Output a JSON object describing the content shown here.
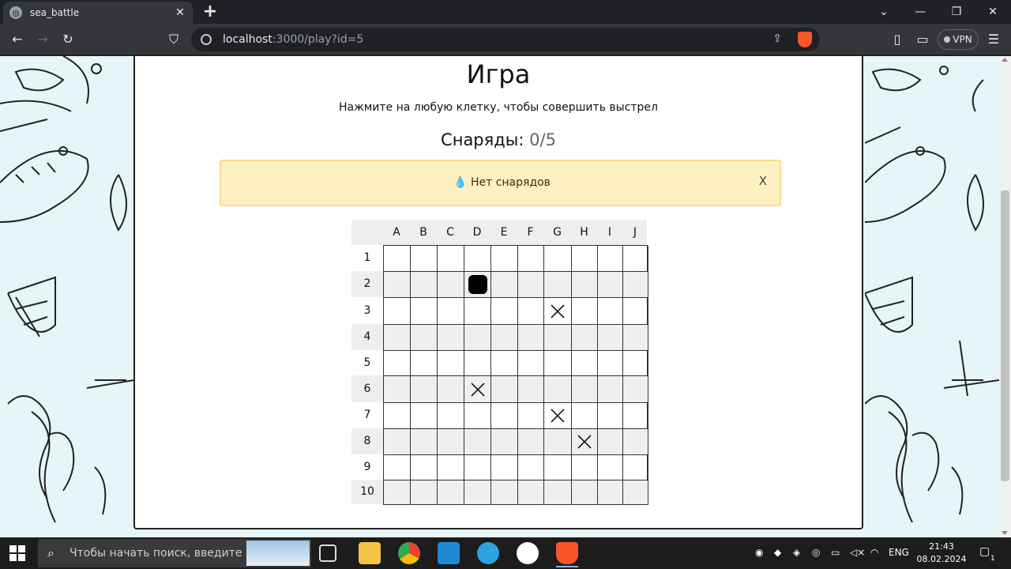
{
  "browser": {
    "tab_title": "sea_battle",
    "url_host": "localhost",
    "url_rest": ":3000/play?id=5",
    "vpn_label": "VPN"
  },
  "page": {
    "title": "Игра",
    "instructions": "Нажмите на любую клетку, чтобы совершить выстрел",
    "ammo_label": "Снаряды:",
    "ammo_value": "0/5",
    "alert_icon": "💧",
    "alert_text": "Нет снарядов",
    "alert_close": "X"
  },
  "board": {
    "columns": [
      "A",
      "B",
      "C",
      "D",
      "E",
      "F",
      "G",
      "H",
      "I",
      "J"
    ],
    "rows": [
      "1",
      "2",
      "3",
      "4",
      "5",
      "6",
      "7",
      "8",
      "9",
      "10"
    ],
    "hits": [
      "D2"
    ],
    "misses": [
      "G3",
      "D6",
      "G7",
      "H8"
    ]
  },
  "taskbar": {
    "search_placeholder": "Чтобы начать поиск, введите",
    "language": "ENG",
    "time": "21:43",
    "date": "08.02.2024",
    "notifications": "1"
  }
}
